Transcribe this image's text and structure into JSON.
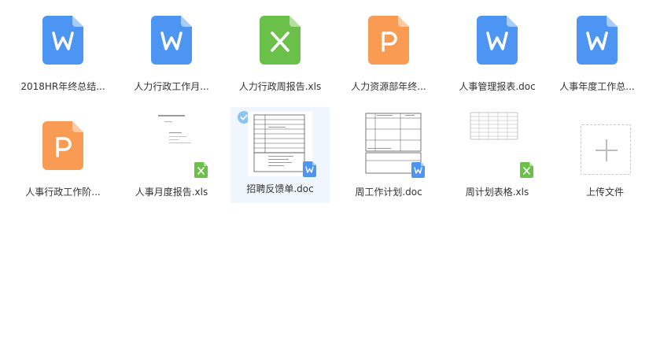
{
  "files": [
    {
      "name": "2018HR年终总结...",
      "type": "doc"
    },
    {
      "name": "人力行政工作月...",
      "type": "doc"
    },
    {
      "name": "人力行政周报告.xls",
      "type": "xls"
    },
    {
      "name": "人力资源部年终...",
      "type": "ppt"
    },
    {
      "name": "人事管理报表.doc",
      "type": "doc"
    },
    {
      "name": "人事年度工作总...",
      "type": "doc"
    },
    {
      "name": "人事行政工作阶...",
      "type": "ppt"
    },
    {
      "name": "人事月度报告.xls",
      "type": "xls"
    },
    {
      "name": "招聘反馈单.doc",
      "type": "doc",
      "selected": true
    },
    {
      "name": "周工作计划.doc",
      "type": "doc"
    },
    {
      "name": "周计划表格.xls",
      "type": "xls"
    }
  ],
  "upload": {
    "label": "上传文件"
  },
  "icons": {
    "doc": {
      "letter": "W",
      "color": "#4d95f2",
      "fold": "#a9cbf9"
    },
    "xls": {
      "letter": "X",
      "color": "#6bc04a",
      "fold": "#b4df9f"
    },
    "ppt": {
      "letter": "P",
      "color": "#f99b52",
      "fold": "#fcc9a1"
    }
  },
  "selection_color": "#f0f6fd",
  "check_color": "#8ec3f4"
}
